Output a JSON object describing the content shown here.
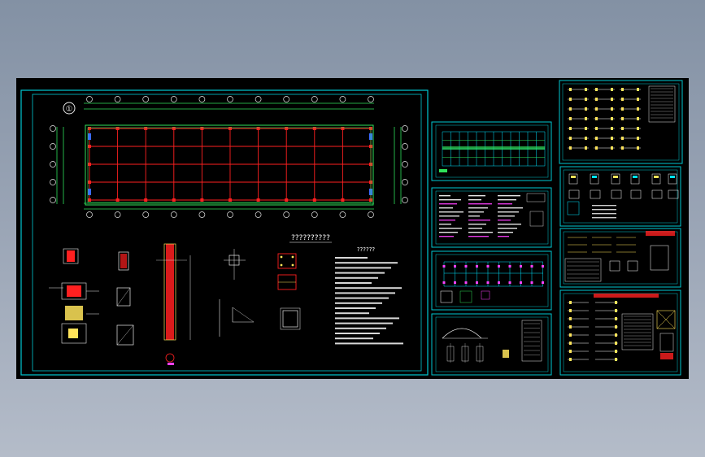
{
  "viewport": {
    "background": "#000000"
  },
  "colors": {
    "frame": "#00c8d2",
    "grid_red": "#ff2020",
    "axis_green": "#2fe05a",
    "bubble_white": "#e8e8e8",
    "text_white": "#ffffff",
    "text_yellow": "#ffe45a",
    "magenta": "#ff40ff",
    "cyan": "#00e5ff"
  },
  "main_sheet": {
    "axis_mark": "①",
    "plan_title": "??????????",
    "notes_title": "??????",
    "grid_columns": 11,
    "grid_rows": 5
  },
  "thumbnails": [
    {
      "name": "frame-elevation-sheet"
    },
    {
      "name": "design-notes-sheet"
    },
    {
      "name": "column-layout-sheet"
    },
    {
      "name": "roof-truss-sheet"
    },
    {
      "name": "beam-details-sheet-1"
    },
    {
      "name": "connection-details-sheet"
    },
    {
      "name": "beam-details-sheet-2"
    },
    {
      "name": "beam-details-sheet-3"
    }
  ]
}
